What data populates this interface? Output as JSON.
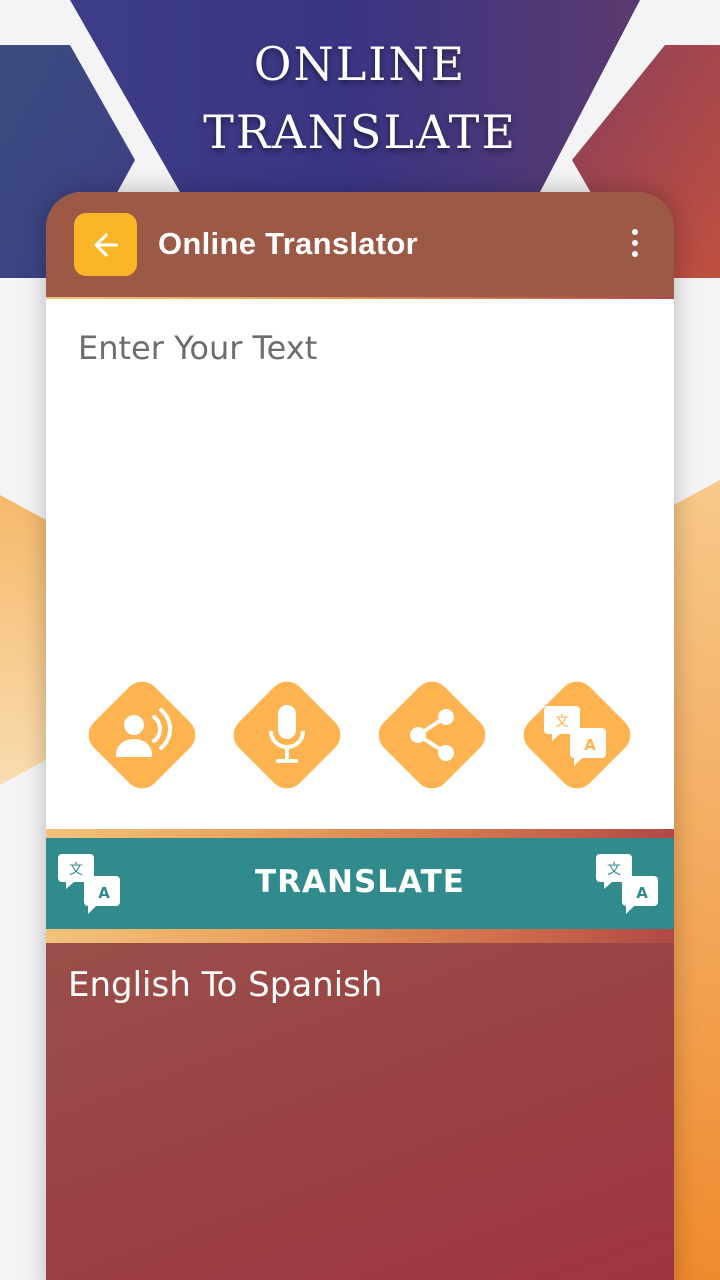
{
  "promo": {
    "line1": "ONLINE",
    "line2": "TRANSLATE"
  },
  "appbar": {
    "title": "Online Translator",
    "back_icon": "arrow-left-icon",
    "menu_icon": "more-vertical-icon"
  },
  "input": {
    "placeholder": "Enter Your Text",
    "value": ""
  },
  "actions": [
    {
      "name": "speak-text-button",
      "icon": "speaker-person-icon"
    },
    {
      "name": "voice-input-button",
      "icon": "microphone-icon"
    },
    {
      "name": "share-button",
      "icon": "share-icon"
    },
    {
      "name": "translate-language-button",
      "icon": "translate-icon"
    }
  ],
  "translate_bar": {
    "label": "TRANSLATE",
    "icon": "translate-icon"
  },
  "output": {
    "label": "English To Spanish"
  },
  "colors": {
    "appbar": "#9b5946",
    "accent_yellow": "#fbb627",
    "action_orange": "#fdb34f",
    "translate_teal": "#318b8c",
    "output_red": "#9a4143",
    "promo_purple": "#3d3a86"
  }
}
